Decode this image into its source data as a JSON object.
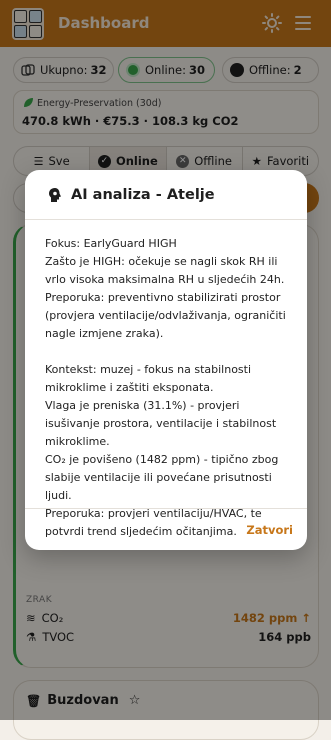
{
  "header": {
    "title": "Dashboard"
  },
  "stats": {
    "total_label": "Ukupno:",
    "total_value": "32",
    "online_label": "Online:",
    "online_value": "30",
    "offline_label": "Offline:",
    "offline_value": "2"
  },
  "energy": {
    "label": "Energy-Preservation (30d)",
    "summary": "470.8 kWh · €75.3 · 108.3 kg CO2"
  },
  "tabs": [
    {
      "label": "Sve"
    },
    {
      "label": "Online"
    },
    {
      "label": "Offline"
    },
    {
      "label": "Favoriti"
    }
  ],
  "card": {
    "section": "ZRAK",
    "co2_label": "CO₂",
    "co2_value": "1482 ppm ↑",
    "tvoc_label": "TVOC",
    "tvoc_value": "164 ppb"
  },
  "card2": {
    "name": "Buzdovan"
  },
  "modal": {
    "title": "AI analiza - Atelje",
    "p1": "Fokus: EarlyGuard HIGH",
    "p2": "Zašto je HIGH: očekuje se nagli skok RH ili vrlo visoka maksimalna RH u sljedećih 24h.",
    "p3": "Preporuka: preventivno stabilizirati prostor (provjera ventilacije/odvlaživanja, ograničiti nagle izmjene zraka).",
    "p4": "Kontekst: muzej - fokus na stabilnosti mikroklime i zaštiti eksponata.",
    "p5": "Vlaga je preniska (31.1%) - provjeri isušivanje prostora, ventilacije i stabilnost mikroklime.",
    "p6": "CO₂ je povišeno (1482 ppm) - tipično zbog slabije ventilacije ili povećane prisutnosti ljudi.",
    "p7": "Preporuka: provjeri ventilaciju/HVAC, te potvrdi trend sljedećim očitanjima.",
    "close_label": "Zatvori"
  },
  "colors": {
    "accent": "#c7771a",
    "online": "#3aa64a",
    "offline": "#1f1f1f"
  }
}
